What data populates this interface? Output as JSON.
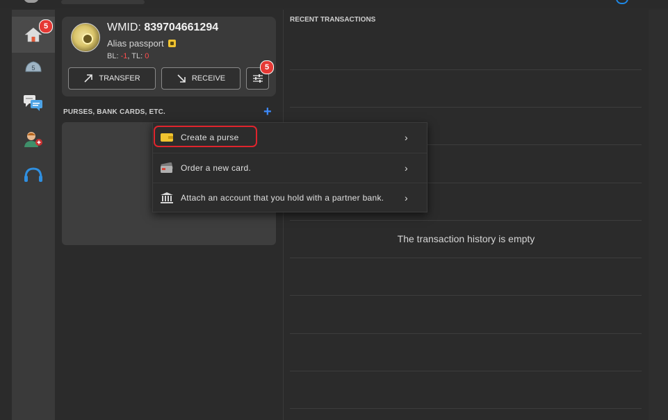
{
  "nav": {
    "items": [
      {
        "name": "home",
        "badge": "5"
      },
      {
        "name": "purses",
        "glyph": "5"
      },
      {
        "name": "messages"
      },
      {
        "name": "contacts"
      },
      {
        "name": "support"
      }
    ]
  },
  "account": {
    "wmid_prefix": "WMID: ",
    "wmid": "839704661294",
    "alias": "Alias passport",
    "bl_label": "BL: ",
    "bl_value": "-1",
    "separator": ", ",
    "tl_label": "TL: ",
    "tl_value": "0"
  },
  "actions": {
    "transfer": "TRANSFER",
    "receive": "RECEIVE",
    "settings_badge": "5"
  },
  "purses": {
    "label": "PURSES, BANK CARDS, ETC.",
    "add": "+"
  },
  "menu": {
    "items": [
      {
        "label": "Create a purse",
        "icon": "wallet-icon"
      },
      {
        "label": "Order a new card.",
        "icon": "card-icon"
      },
      {
        "label": "Attach an account that you hold with a partner bank.",
        "icon": "bank-icon"
      }
    ],
    "chevron": "›"
  },
  "transactions": {
    "title": "RECENT TRANSACTIONS",
    "empty": "The transaction history is empty"
  },
  "colors": {
    "accent": "#3d8bff",
    "badge": "#e53935",
    "highlight": "#e0242d",
    "wallet": "#f0c330"
  }
}
